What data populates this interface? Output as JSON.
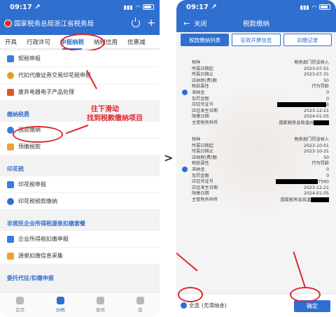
{
  "left": {
    "status_time": "09:17",
    "status_arrow": "↗",
    "header_title": "国家税务总局浙江省税务局",
    "tabs": [
      "开具",
      "行政许可",
      "申报纳税",
      "纳税信用",
      "优惠减"
    ],
    "items_top": [
      "契税申报",
      "代扣代缴证券交易印花税申报",
      "废弃电器电子产品处理"
    ],
    "section_payment": "缴纳税费",
    "payment_items": [
      "税款缴纳",
      "预缴税款"
    ],
    "section_stamp": "印花税",
    "stamp_items": [
      "印花税申报",
      "印花税税款缴纳"
    ],
    "section_nonresident": "非居民企业所得税源泉扣缴套餐",
    "nonresident_items": [
      "企业所得税扣缴申报",
      "源泉扣缴信息采集"
    ],
    "section_agency": "委托代征/扣缴申报",
    "annotation_line1": "往下滑动",
    "annotation_line2": "找到税款缴纳项目",
    "bottom_nav": [
      "首页",
      "办税",
      "服务",
      "我"
    ]
  },
  "right": {
    "status_time": "09:17",
    "status_arrow": "↗",
    "back_label": "关闭",
    "title": "税款缴纳",
    "tabs": [
      "税款缴纳列表",
      "征收开票信息",
      "扣缴记录"
    ],
    "record1": {
      "rows": [
        {
          "k": "税种",
          "v": "税务部门罚没收入"
        },
        {
          "k": "所属日期起",
          "v": "2023-07-01"
        },
        {
          "k": "所属日期止",
          "v": "2023-07-31"
        },
        {
          "k": "应纳税(费)额",
          "v": "50"
        },
        {
          "k": "税款属性",
          "v": "行为罚款"
        },
        {
          "k": "滞纳金",
          "v": "0"
        },
        {
          "k": "加罚金额",
          "v": "0"
        },
        {
          "k": "应征凭证号",
          "v": "4"
        },
        {
          "k": "应征发生日期",
          "v": "2023-12-21"
        },
        {
          "k": "限缴日期",
          "v": "2024-01-05"
        },
        {
          "k": "主管税务科所",
          "v": "国家税务总局温州"
        }
      ]
    },
    "record2": {
      "rows": [
        {
          "k": "税种",
          "v": "税务部门罚没收入"
        },
        {
          "k": "所属日期起",
          "v": "2023-10-01"
        },
        {
          "k": "所属日期止",
          "v": "2023-10-31"
        },
        {
          "k": "应纳税(费)额",
          "v": "50"
        },
        {
          "k": "税款属性",
          "v": "行为罚款"
        },
        {
          "k": "滞纳金",
          "v": "0"
        },
        {
          "k": "加罚金额",
          "v": "0"
        },
        {
          "k": "应征凭证号",
          "v": "7560"
        },
        {
          "k": "应征发生日期",
          "v": "2023-12-21"
        },
        {
          "k": "限缴日期",
          "v": "2024-01-05"
        },
        {
          "k": "主管税务科所",
          "v": "国家税务总局温"
        }
      ]
    },
    "select_all": "全选",
    "select_all_note": "(无滞纳金)",
    "confirm": "确定"
  },
  "mid_arrow": ">",
  "colors": {
    "primary": "#2f6fd0",
    "annotation": "#e1252f"
  }
}
